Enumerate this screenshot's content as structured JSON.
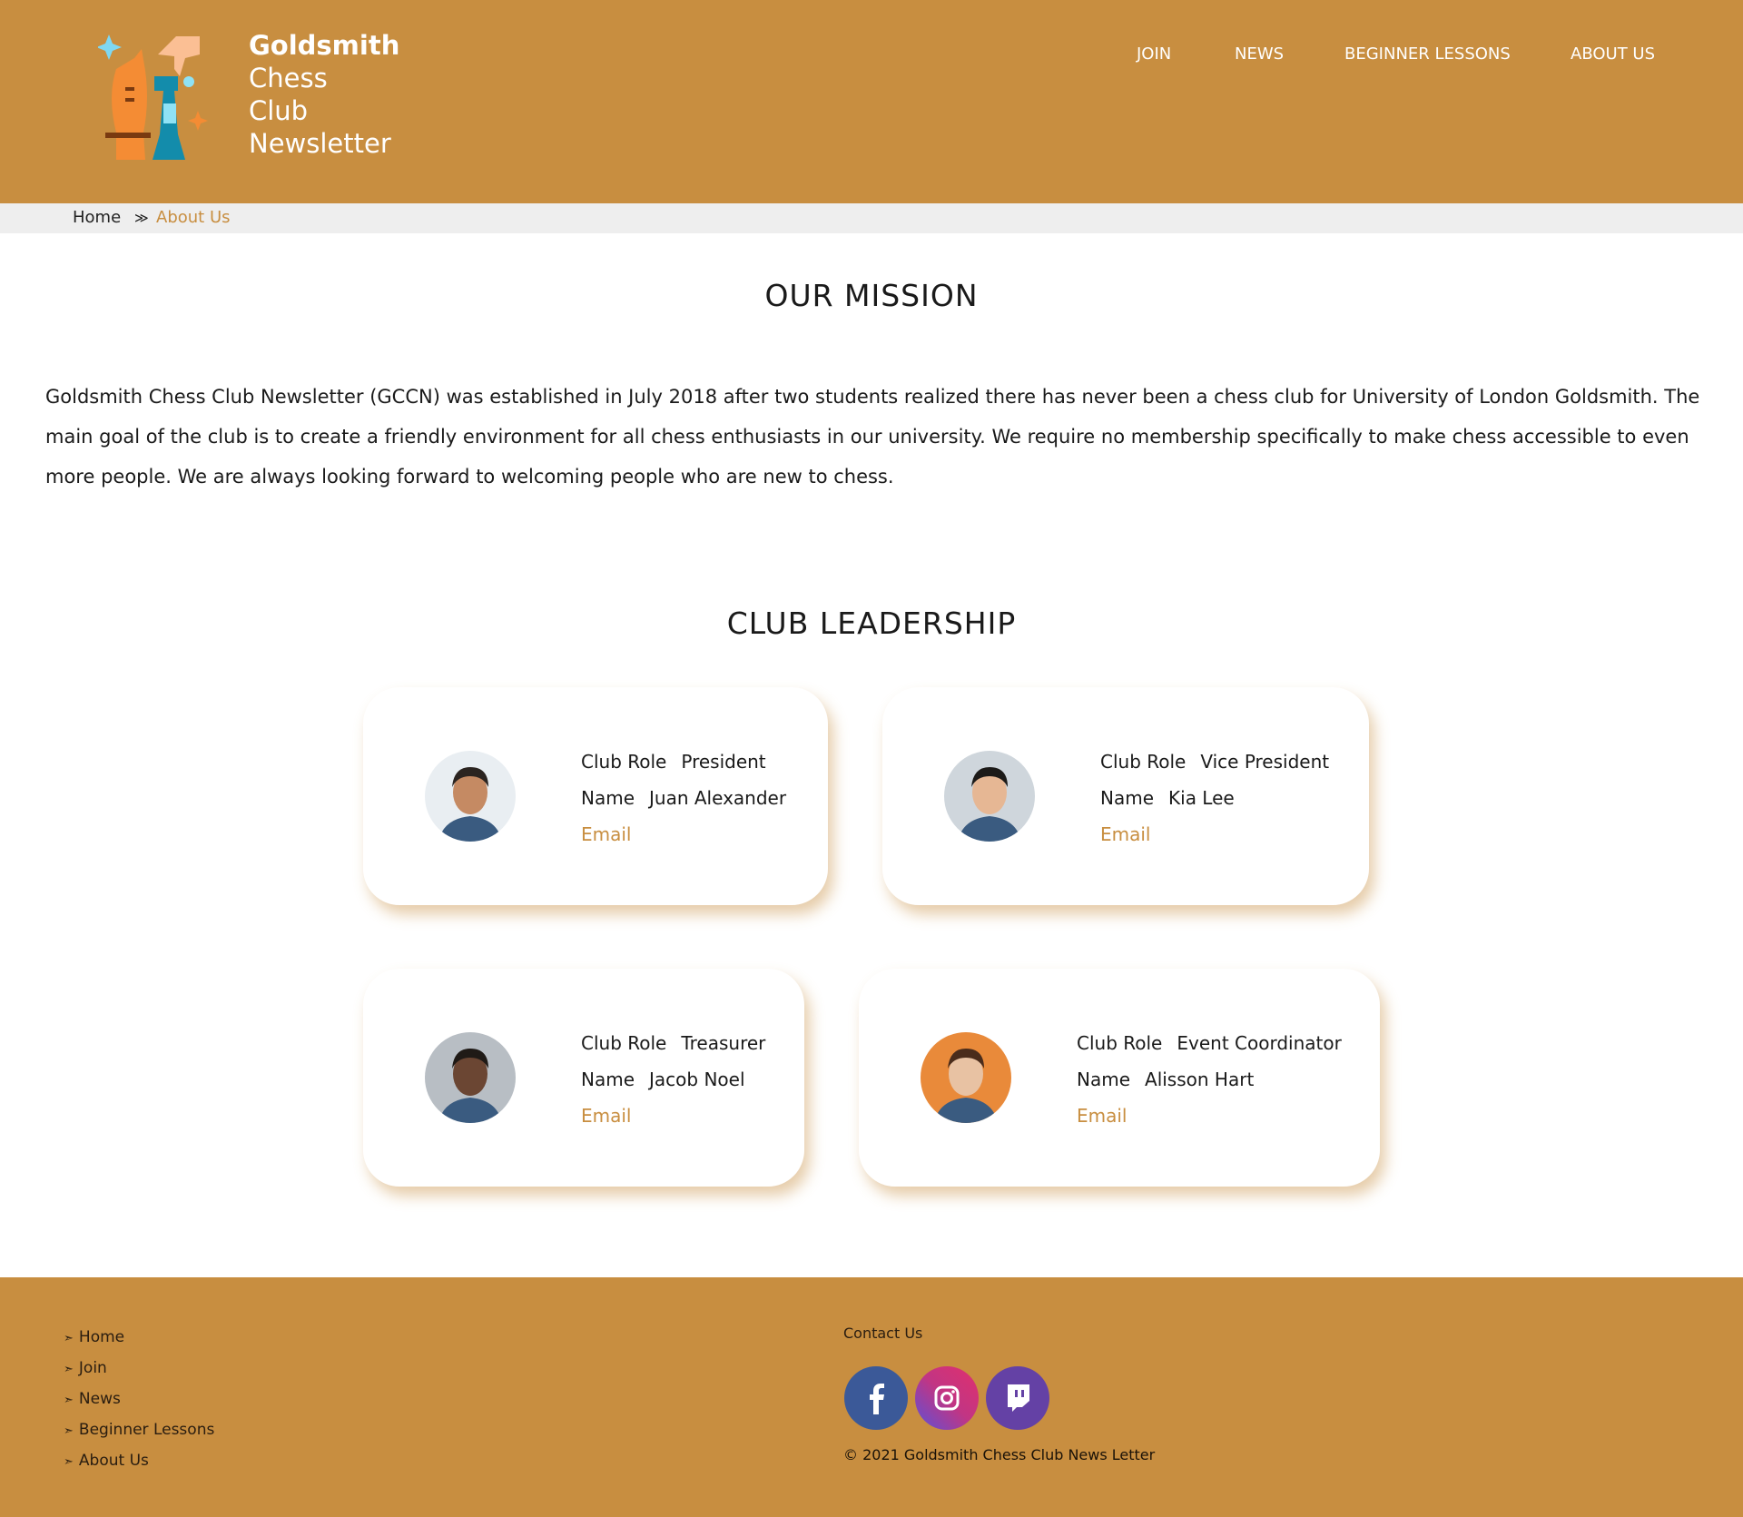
{
  "logo": {
    "line1": "Goldsmith",
    "line2": "Chess",
    "line3": "Club",
    "line4": "Newsletter"
  },
  "nav": [
    "JOIN",
    "NEWS",
    "BEGINNER LESSONS",
    "ABOUT US"
  ],
  "breadcrumb": {
    "home": "Home",
    "sep": "≫",
    "current": "About Us"
  },
  "mission": {
    "title": "OUR MISSION",
    "text": "Goldsmith Chess Club Newsletter (GCCN) was established in July 2018 after two students realized there has never been a chess club for University of London Goldsmith. The main goal of the club is to create a friendly environment for all chess enthusiasts in our university. We require no membership specifically to make chess accessible to even more people. We are always looking forward to welcoming people who are new to chess."
  },
  "leadership": {
    "title": "CLUB LEADERSHIP",
    "role_label": "Club Role",
    "name_label": "Name",
    "email_label": "Email",
    "members": [
      {
        "role": "President",
        "name": "Juan Alexander"
      },
      {
        "role": "Vice President",
        "name": "Kia Lee"
      },
      {
        "role": "Treasurer",
        "name": "Jacob Noel"
      },
      {
        "role": "Event Coordinator",
        "name": "Alisson Hart"
      }
    ]
  },
  "footer": {
    "links": [
      "Home",
      "Join",
      "News",
      "Beginner Lessons",
      "About Us"
    ],
    "arrow": "➣",
    "contact": "Contact Us",
    "copyright": "© 2021 Goldsmith Chess Club News Letter",
    "social": [
      "facebook-icon",
      "instagram-icon",
      "twitch-icon"
    ]
  },
  "colors": {
    "brand": "#c88e40"
  }
}
